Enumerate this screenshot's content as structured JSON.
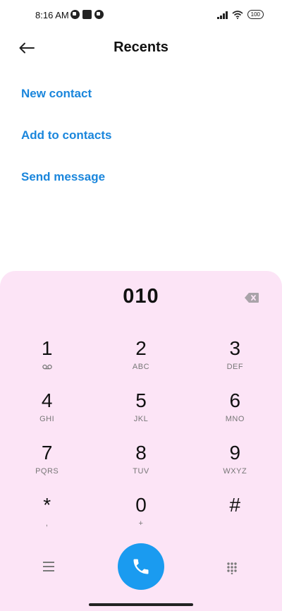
{
  "status_bar": {
    "time": "8:16 AM",
    "battery": "100"
  },
  "header": {
    "title": "Recents",
    "back_icon": "arrow-left-icon"
  },
  "actions": [
    {
      "label": "New contact"
    },
    {
      "label": "Add to contacts"
    },
    {
      "label": "Send message"
    }
  ],
  "dialer": {
    "number": "010",
    "keys": [
      {
        "digit": "1",
        "letters": ""
      },
      {
        "digit": "2",
        "letters": "ABC"
      },
      {
        "digit": "3",
        "letters": "DEF"
      },
      {
        "digit": "4",
        "letters": "GHI"
      },
      {
        "digit": "5",
        "letters": "JKL"
      },
      {
        "digit": "6",
        "letters": "MNO"
      },
      {
        "digit": "7",
        "letters": "PQRS"
      },
      {
        "digit": "8",
        "letters": "TUV"
      },
      {
        "digit": "9",
        "letters": "WXYZ"
      },
      {
        "digit": "*",
        "letters": ","
      },
      {
        "digit": "0",
        "letters": "+"
      },
      {
        "digit": "#",
        "letters": ""
      }
    ]
  },
  "colors": {
    "accent": "#1a86dc",
    "call_button": "#1a9bf0",
    "dialpad_bg": "#fce4f6"
  }
}
